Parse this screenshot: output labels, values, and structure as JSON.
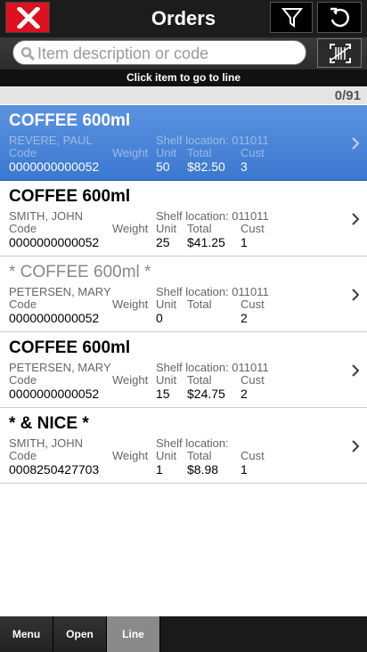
{
  "header": {
    "title": "Orders"
  },
  "search": {
    "placeholder": "Item description or code"
  },
  "hint": "Click item to go to line",
  "counter": "0/91",
  "labels": {
    "code": "Code",
    "weight": "Weight",
    "unit": "Unit",
    "total": "Total",
    "cust": "Cust"
  },
  "items": [
    {
      "name": "COFFEE 600ml",
      "customer": "REVERE, PAUL",
      "shelf": "Shelf location: 011011",
      "code": "0000000000052",
      "unit": "50",
      "total": "$82.50",
      "cust": "3",
      "selected": true,
      "dim": false
    },
    {
      "name": "COFFEE 600ml",
      "customer": "SMITH, JOHN",
      "shelf": "Shelf location: 011011",
      "code": "0000000000052",
      "unit": "25",
      "total": "$41.25",
      "cust": "1",
      "selected": false,
      "dim": false
    },
    {
      "name": "* COFFEE 600ml *",
      "customer": "PETERSEN, MARY",
      "shelf": "Shelf location: 011011",
      "code": "0000000000052",
      "unit": "0",
      "total": "",
      "cust": "2",
      "selected": false,
      "dim": true
    },
    {
      "name": "COFFEE 600ml",
      "customer": "PETERSEN, MARY",
      "shelf": "Shelf location: 011011",
      "code": "0000000000052",
      "unit": "15",
      "total": "$24.75",
      "cust": "2",
      "selected": false,
      "dim": false
    },
    {
      "name": "* & NICE *",
      "customer": "SMITH, JOHN",
      "shelf": "Shelf location:",
      "code": "0008250427703",
      "unit": "1",
      "total": "$8.98",
      "cust": "1",
      "selected": false,
      "dim": false
    }
  ],
  "tabs": [
    {
      "label": "Menu"
    },
    {
      "label": "Open"
    },
    {
      "label": "Line"
    }
  ],
  "colors": {
    "close": "#e01020",
    "selected": "#3c78d0",
    "topbar": "#1c1c1c"
  },
  "icons": {
    "close": "close-icon",
    "filter": "filter-icon",
    "refresh": "refresh-icon",
    "search": "search-icon",
    "scan": "scan-icon",
    "chevron": "chevron-right-icon"
  }
}
